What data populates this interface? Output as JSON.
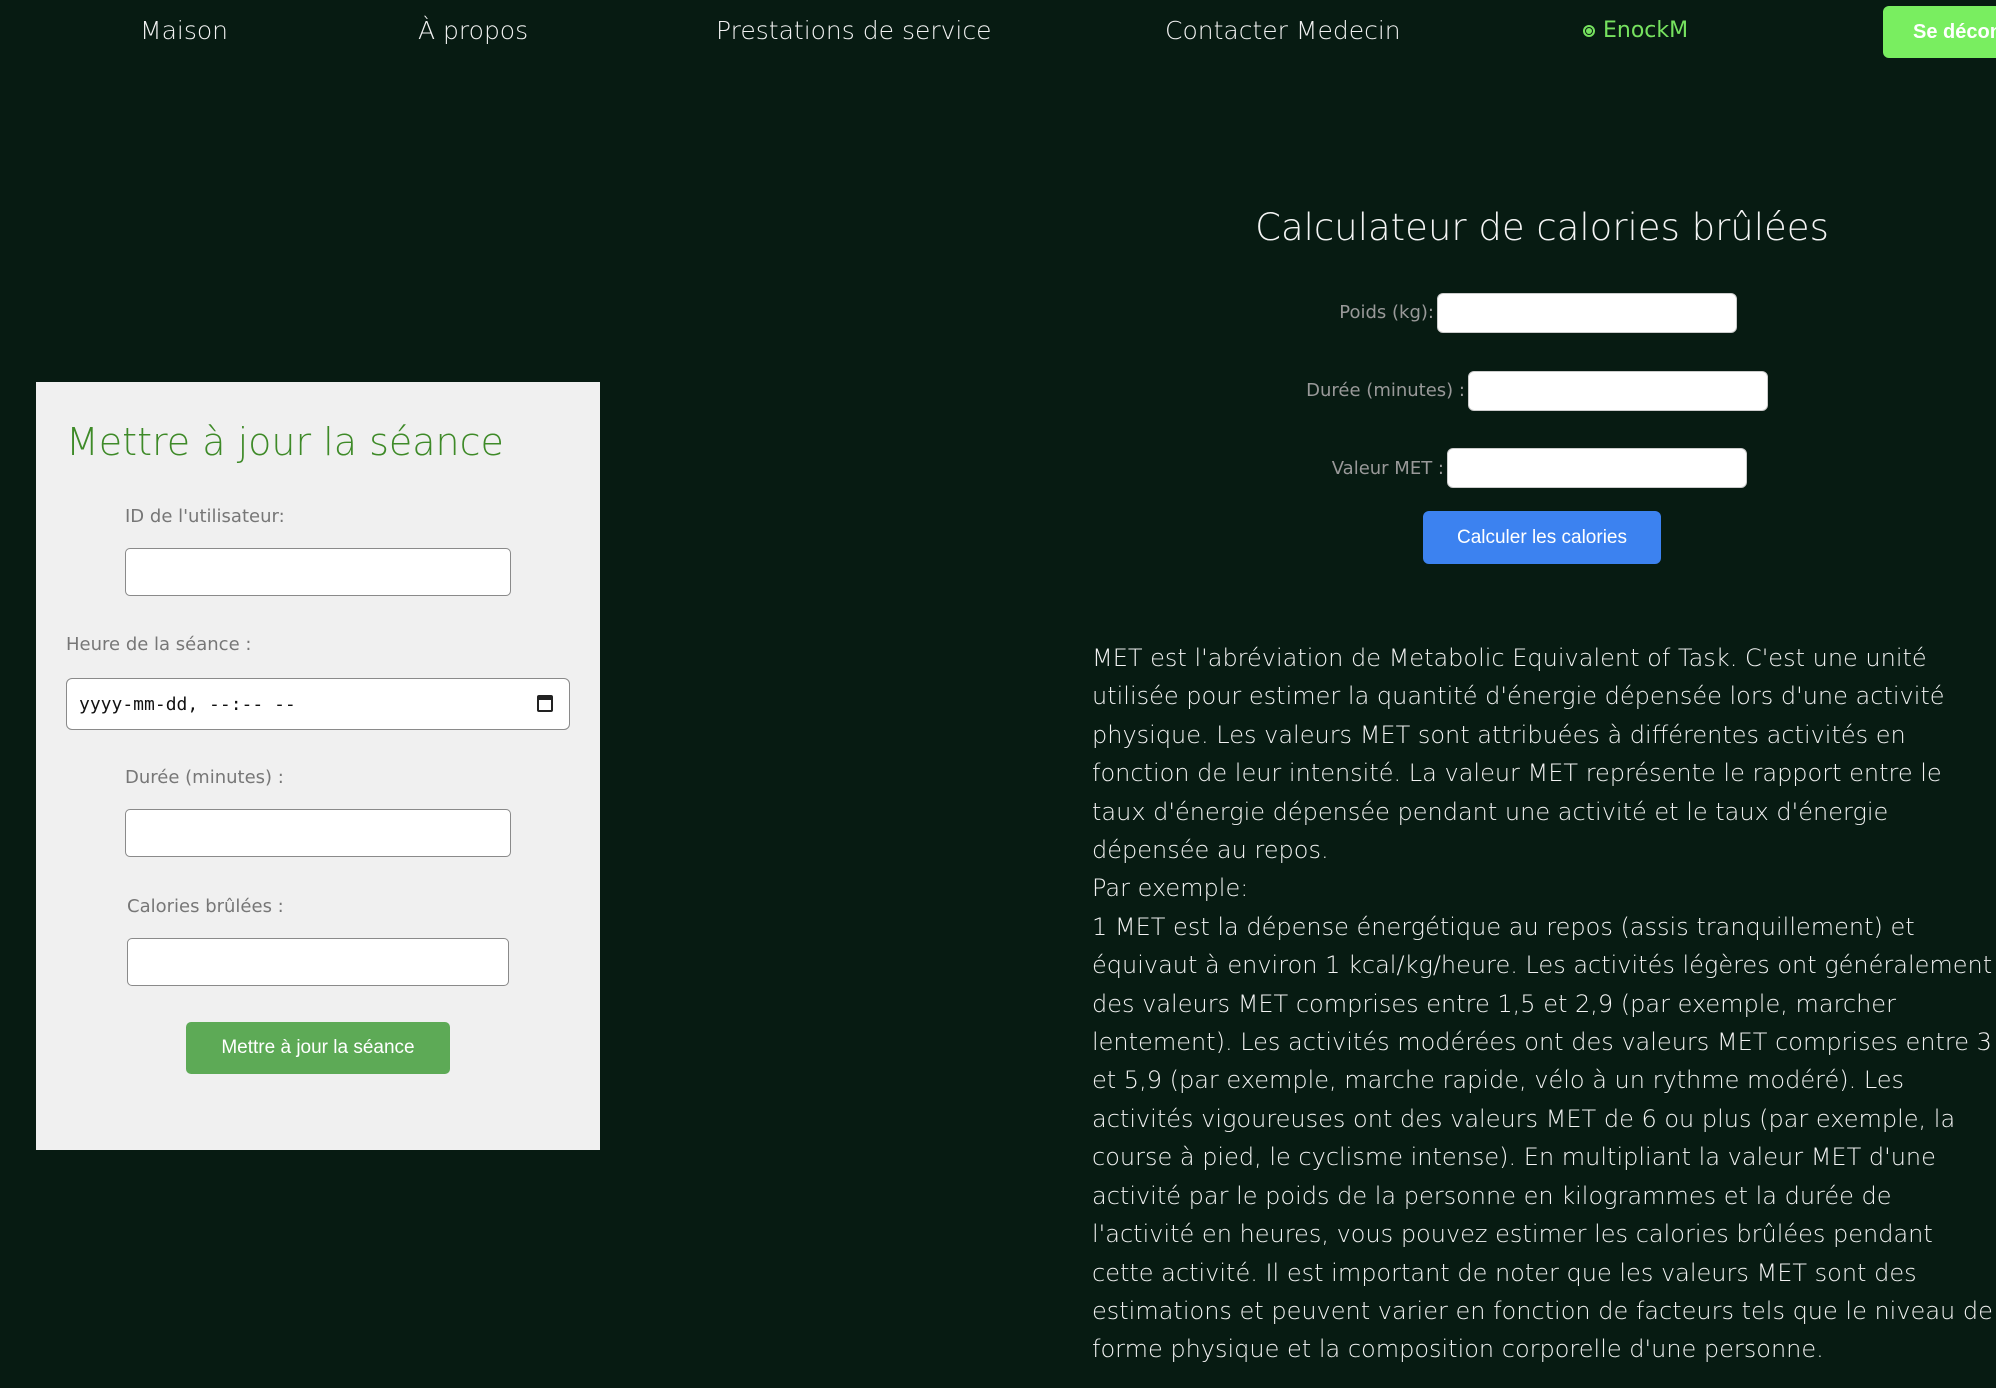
{
  "nav": {
    "home": "Maison",
    "about": "À propos",
    "services": "Prestations de service",
    "contact": "Contacter Medecin",
    "user": "EnockM",
    "logout": "Se déconn"
  },
  "colors": {
    "background": "#071b12",
    "accent_green": "#79ee60",
    "card_title_green": "#3e8a28",
    "update_button": "#5daa56",
    "calc_button": "#3c82f0"
  },
  "update_form": {
    "title": "Mettre à jour la séance",
    "user_id_label": "ID de l'utilisateur:",
    "session_time_label": "Heure de la séance :",
    "session_time_placeholder": "yyyy-mm-dd, --:-- --",
    "duration_label": "Durée (minutes) :",
    "calories_label": "Calories brûlées :",
    "submit": "Mettre à jour la séance"
  },
  "calculator": {
    "title": "Calculateur de calories brûlées",
    "weight_label": "Poids (kg):",
    "duration_label": "Durée (minutes) :",
    "met_label": "Valeur MET :",
    "submit": "Calculer les calories"
  },
  "met_info": {
    "paragraph1": "MET est l'abréviation de Metabolic Equivalent of Task. C'est une unité utilisée pour estimer la quantité d'énergie dépensée lors d'une activité physique. Les valeurs MET sont attribuées à différentes activités en fonction de leur intensité. La valeur MET représente le rapport entre le taux d'énergie dépensée pendant une activité et le taux d'énergie dépensée au repos.",
    "example_heading": "Par exemple:",
    "paragraph2": "1 MET est la dépense énergétique au repos (assis tranquillement) et équivaut à environ 1 kcal/kg/heure. Les activités légères ont généralement des valeurs MET comprises entre 1,5 et 2,9 (par exemple, marcher lentement). Les activités modérées ont des valeurs MET comprises entre 3 et 5,9 (par exemple, marche rapide, vélo à un rythme modéré). Les activités vigoureuses ont des valeurs MET de 6 ou plus (par exemple, la course à pied, le cyclisme intense). En multipliant la valeur MET d'une activité par le poids de la personne en kilogrammes et la durée de l'activité en heures, vous pouvez estimer les calories brûlées pendant cette activité. Il est important de noter que les valeurs MET sont des estimations et peuvent varier en fonction de facteurs tels que le niveau de forme physique et la composition corporelle d'une personne."
  }
}
